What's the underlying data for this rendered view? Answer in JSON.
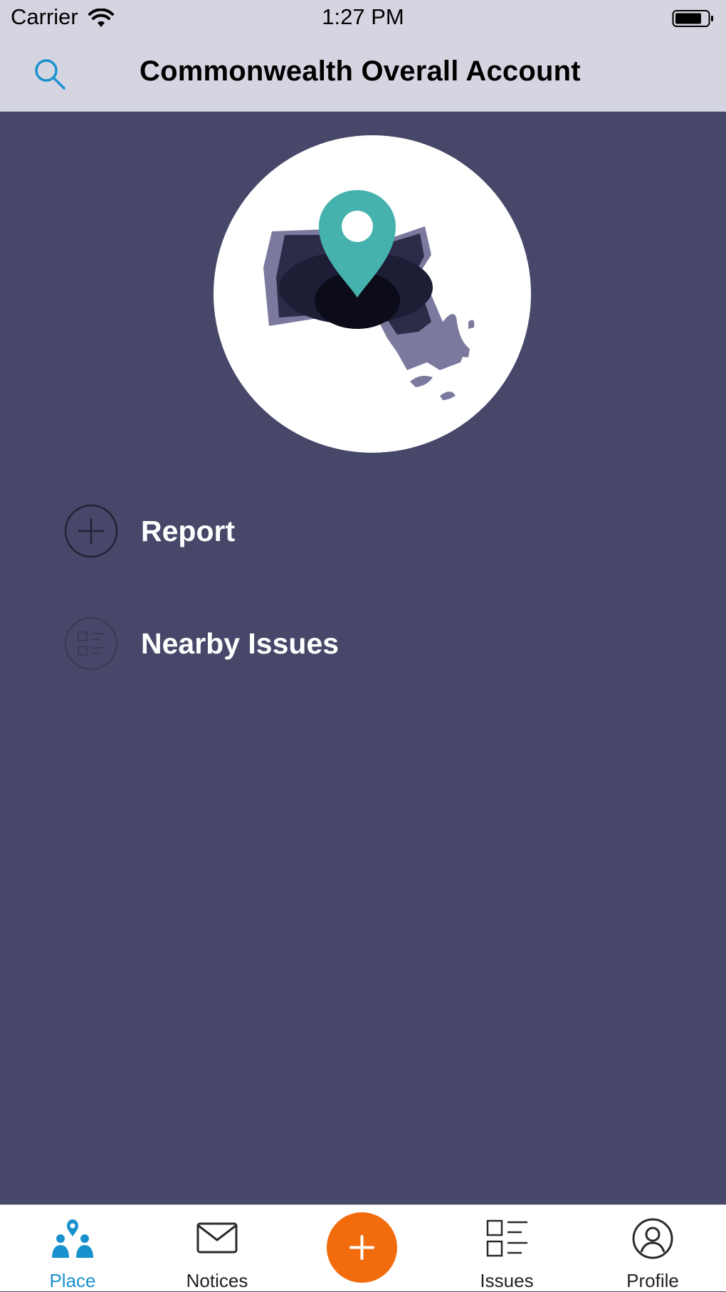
{
  "status_bar": {
    "carrier": "Carrier",
    "time": "1:27 PM"
  },
  "nav": {
    "title": "Commonwealth Overall Account",
    "search_icon": "search-icon"
  },
  "hero": {
    "icon": "massachusetts-map-pin-icon"
  },
  "menu": {
    "items": [
      {
        "label": "Report",
        "icon": "plus-circle-icon"
      },
      {
        "label": "Nearby Issues",
        "icon": "list-circle-icon"
      }
    ]
  },
  "tabbar": {
    "tabs": [
      {
        "label": "Place",
        "icon": "place-people-icon",
        "active": true
      },
      {
        "label": "Notices",
        "icon": "envelope-icon",
        "active": false
      },
      {
        "label": "Issues",
        "icon": "checklist-icon",
        "active": false
      },
      {
        "label": "Profile",
        "icon": "user-circle-icon",
        "active": false
      }
    ],
    "fab_icon": "plus-icon"
  },
  "colors": {
    "background": "#474869",
    "topbar": "#d5d5e1",
    "accent_blue": "#1a91cf",
    "pin_teal": "#45b2ae",
    "fab_orange": "#f26c0d"
  }
}
